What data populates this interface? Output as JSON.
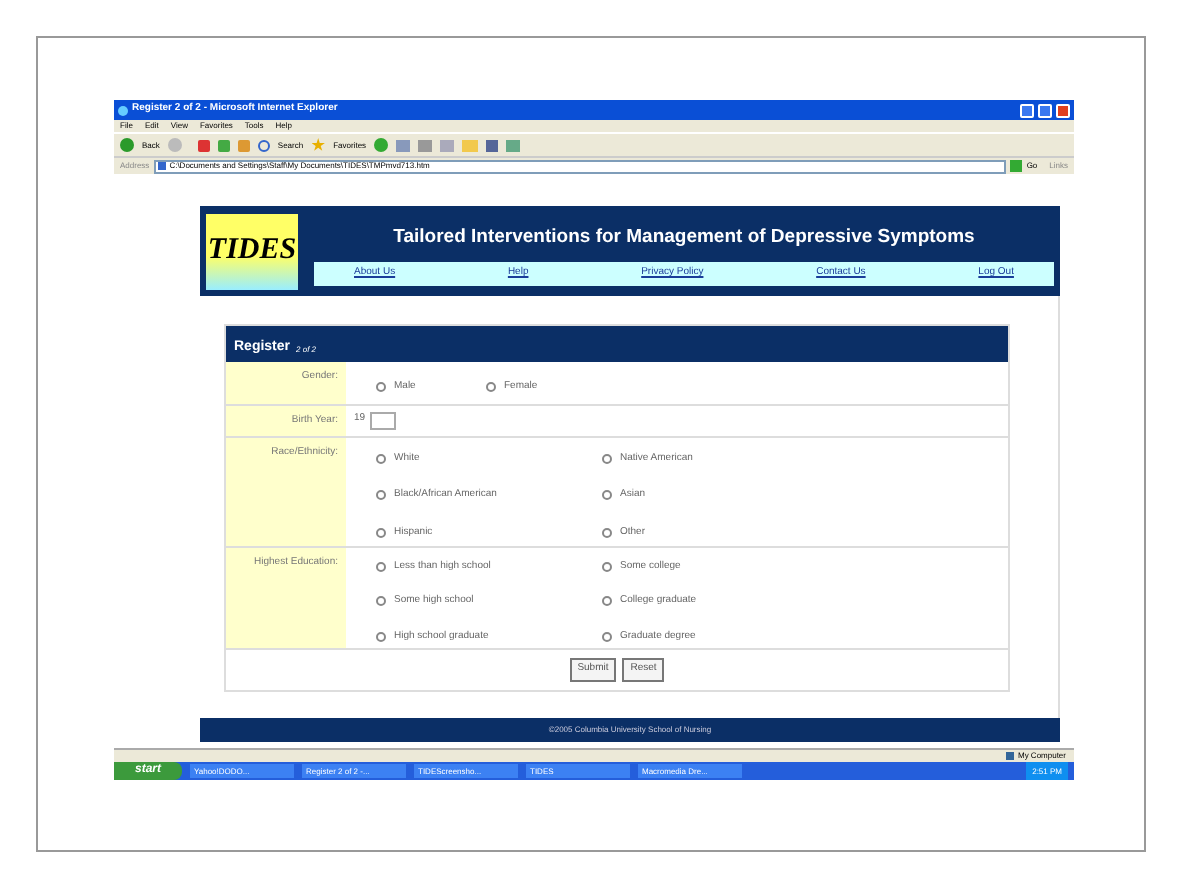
{
  "window": {
    "title": "Register 2 of 2 - Microsoft Internet Explorer"
  },
  "menu": [
    "File",
    "Edit",
    "View",
    "Favorites",
    "Tools",
    "Help"
  ],
  "toolbar": {
    "back": "Back",
    "search": "Search",
    "favorites": "Favorites"
  },
  "address_bar": {
    "label": "Address",
    "value": "C:\\Documents and Settings\\Staff\\My Documents\\TIDES\\TMPmvd713.htm",
    "go": "Go",
    "links": "Links"
  },
  "site": {
    "logo": "TIDES",
    "title": "Tailored Interventions for Management of Depressive Symptoms",
    "nav": [
      "About Us",
      "Help",
      "Privacy Policy",
      "Contact Us",
      "Log Out"
    ]
  },
  "form": {
    "title": "Register",
    "step": "2 of 2",
    "gender": {
      "label": "Gender:",
      "options": [
        {
          "label": "Male",
          "selected": false
        },
        {
          "label": "Female",
          "selected": false
        }
      ]
    },
    "birth_year": {
      "label": "Birth Year:",
      "prefix": "19"
    },
    "race": {
      "label": "Race/Ethnicity:",
      "options": [
        {
          "label": "White",
          "selected": false
        },
        {
          "label": "Native American",
          "selected": false
        },
        {
          "label": "Black/African American",
          "selected": false
        },
        {
          "label": "Asian",
          "selected": false
        },
        {
          "label": "Hispanic",
          "selected": false
        },
        {
          "label": "Other",
          "selected": false
        }
      ]
    },
    "education": {
      "label": "Highest Education:",
      "options": [
        {
          "label": "Less than high school",
          "selected": false
        },
        {
          "label": "Some college",
          "selected": false
        },
        {
          "label": "Some high school",
          "selected": false
        },
        {
          "label": "College graduate",
          "selected": false
        },
        {
          "label": "High school graduate",
          "selected": false
        },
        {
          "label": "Graduate degree",
          "selected": false
        }
      ]
    },
    "buttons": [
      "Submit",
      "Reset"
    ]
  },
  "footer": "©2005 Columbia University School of Nursing",
  "status_bar": {
    "zone": "My Computer"
  },
  "taskbar": {
    "start": "start",
    "items": [
      "Yahoo!DODO...",
      "Register 2 of 2 -...",
      "TIDEScreensho...",
      "TIDES",
      "Macromedia Dre..."
    ],
    "clock": "2:51 PM"
  }
}
